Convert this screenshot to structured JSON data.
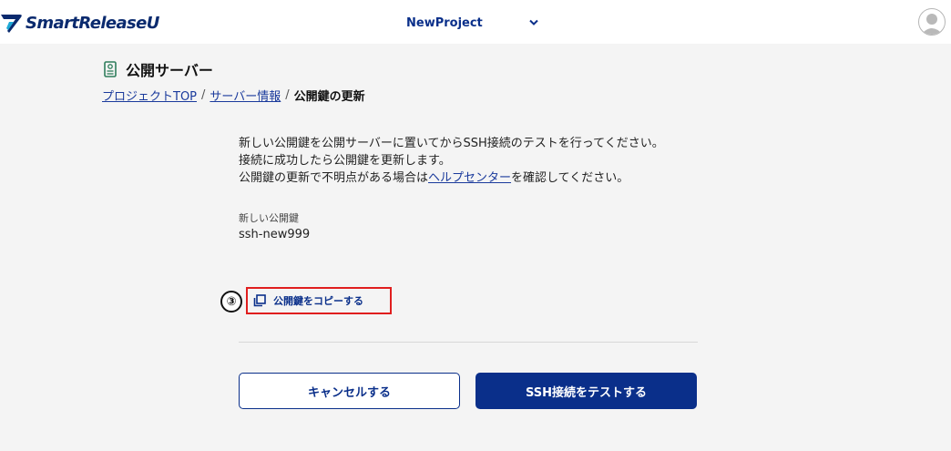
{
  "header": {
    "logo_text": "SmartReleaseU",
    "project_name": "NewProject"
  },
  "page": {
    "title": "公開サーバー"
  },
  "breadcrumb": {
    "items": [
      "プロジェクトTOP",
      "サーバー情報"
    ],
    "separator": "/",
    "current": "公開鍵の更新"
  },
  "description": {
    "line1": "新しい公開鍵を公開サーバーに置いてからSSH接続のテストを行ってください。",
    "line2": "接続に成功したら公開鍵を更新します。",
    "line3_before": "公開鍵の更新で不明点がある場合は",
    "line3_link": "ヘルプセンター",
    "line3_after": "を確認してください。"
  },
  "new_key": {
    "label": "新しい公開鍵",
    "value": "ssh-new999"
  },
  "annotation": {
    "step": "③"
  },
  "copy_button": {
    "label": "公開鍵をコピーする"
  },
  "actions": {
    "cancel_label": "キャンセルする",
    "test_label": "SSH接続をテストする"
  },
  "colors": {
    "brand": "#0a2f8a",
    "highlight": "#e01e1e",
    "link": "#1a3a9c"
  },
  "icons": {
    "logo": "logo-mark-icon",
    "chevron": "chevron-down-icon",
    "avatar": "user-avatar-icon",
    "server": "server-icon",
    "copy": "copy-icon"
  }
}
